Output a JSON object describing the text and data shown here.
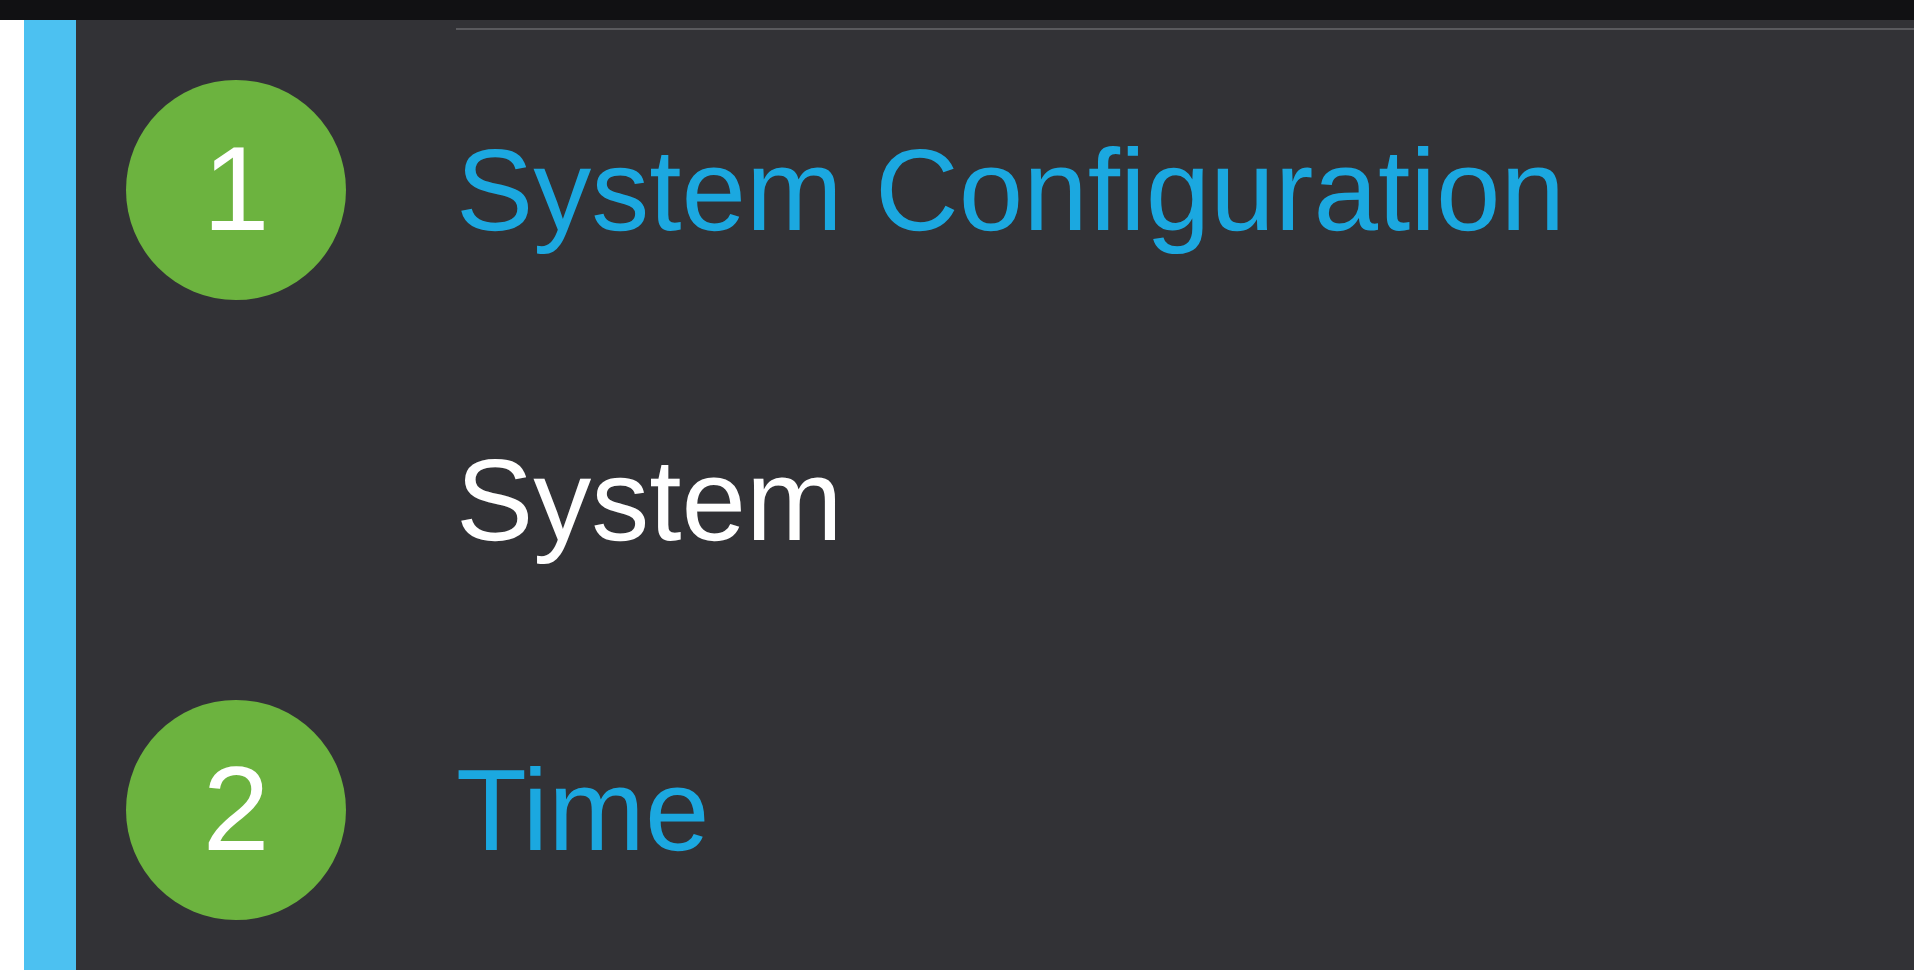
{
  "menu": [
    {
      "kind": "step",
      "number": "1",
      "label": "System Configuration"
    },
    {
      "kind": "item",
      "label": "System"
    },
    {
      "kind": "step",
      "number": "2",
      "label": "Time"
    }
  ]
}
